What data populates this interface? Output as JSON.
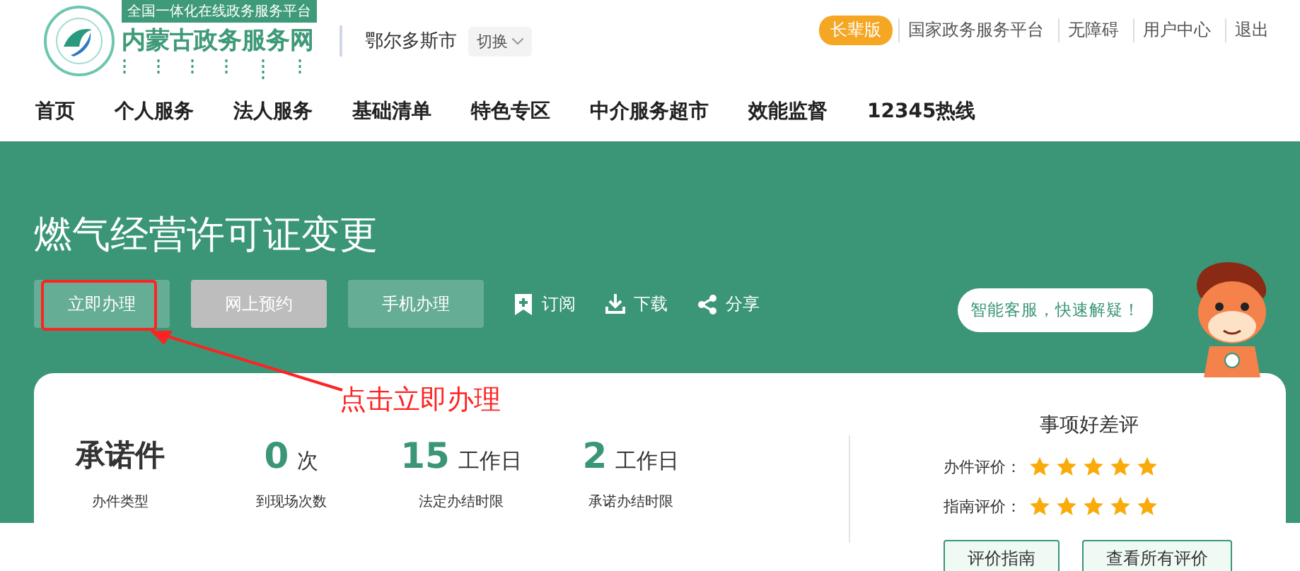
{
  "header": {
    "logo": {
      "slogan": "全国一体化在线政务服务平台",
      "site_name": "内蒙古政务服务网"
    },
    "city": "鄂尔多斯市",
    "switch_label": "切换",
    "elder_badge": "长辈版",
    "top_links": [
      "国家政务服务平台",
      "无障碍",
      "用户中心",
      "退出"
    ]
  },
  "nav": {
    "items": [
      {
        "label": "首页",
        "selected": false
      },
      {
        "label": "个人服务",
        "selected": false
      },
      {
        "label": "法人服务",
        "selected": false
      },
      {
        "label": "基础清单",
        "selected": false
      },
      {
        "label": "特色专区",
        "selected": false
      },
      {
        "label": "中介服务超市",
        "selected": false
      },
      {
        "label": "效能监督",
        "selected": false
      },
      {
        "label": "12345热线",
        "selected": false
      }
    ]
  },
  "hero": {
    "title": "燃气经营许可证变更",
    "buttons": [
      {
        "label": "立即办理",
        "kind": "primary"
      },
      {
        "label": "网上预约",
        "kind": "disabled"
      },
      {
        "label": "手机办理",
        "kind": "primary"
      }
    ],
    "actions": [
      {
        "label": "订阅",
        "kind": "bookmark"
      },
      {
        "label": "下载",
        "kind": "download"
      },
      {
        "label": "分享",
        "kind": "share"
      }
    ],
    "assistant_bubble": "智能客服，快速解疑！"
  },
  "annotation": {
    "text": "点击立即办理"
  },
  "summary": {
    "stats": [
      {
        "value": "承诺件",
        "kind": "text",
        "caption": "办件类型"
      },
      {
        "value": "0",
        "unit": "次",
        "kind": "number",
        "caption": "到现场次数"
      },
      {
        "value": "15",
        "unit": "工作日",
        "kind": "number",
        "caption": "法定办结时限"
      },
      {
        "value": "2",
        "unit": "工作日",
        "kind": "number",
        "caption": "承诺办结时限"
      }
    ],
    "rating": {
      "title": "事项好差评",
      "rows": [
        {
          "label": "办件评价：",
          "stars": 5
        },
        {
          "label": "指南评价：",
          "stars": 5
        }
      ],
      "buttons": [
        "评价指南",
        "查看所有评价"
      ]
    }
  }
}
